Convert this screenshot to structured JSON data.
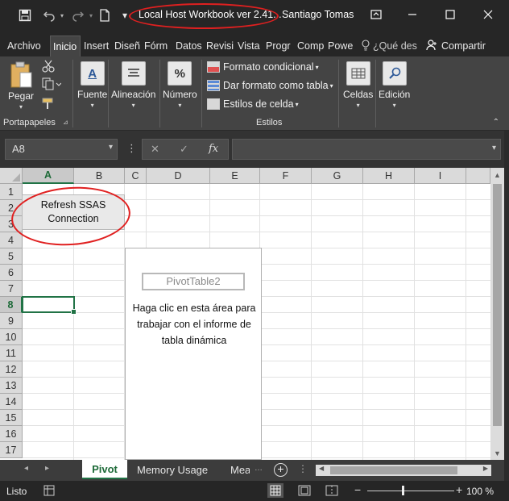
{
  "titlebar": {
    "title": "Local Host Workbook ver 2.41...",
    "user": "Santiago Tomas",
    "save_icon": "save-icon",
    "undo_icon": "undo-icon",
    "redo_icon": "redo-icon",
    "new_icon": "new-file-icon"
  },
  "tabs": {
    "archivo": "Archivo",
    "inicio": "Inicio",
    "insert": "Insert",
    "diseno": "Diseñ",
    "formulas": "Fórm",
    "datos": "Datos",
    "revisar": "Revisi",
    "vista": "Vista",
    "progr": "Progr",
    "comp": "Comp",
    "power": "Powe",
    "tell_me": "¿Qué des",
    "share": "Compartir"
  },
  "ribbon": {
    "pegar": "Pegar",
    "portapapeles": "Portapapeles",
    "fuente": "Fuente",
    "alineacion": "Alineación",
    "numero": "Número",
    "percent": "%",
    "formato_condicional": "Formato condicional",
    "dar_formato_tabla": "Dar formato como tabla",
    "estilos_celda": "Estilos de celda",
    "estilos": "Estilos",
    "celdas": "Celdas",
    "edicion": "Edición"
  },
  "formula_bar": {
    "name_box": "A8",
    "formula": ""
  },
  "grid": {
    "columns": [
      "A",
      "B",
      "C",
      "D",
      "E",
      "F",
      "G",
      "H",
      "I"
    ],
    "rows": [
      "1",
      "2",
      "3",
      "4",
      "5",
      "6",
      "7",
      "8",
      "9",
      "10",
      "11",
      "12",
      "13",
      "14",
      "15",
      "16",
      "17"
    ],
    "selected_cell": "A8"
  },
  "refresh_button": {
    "line1": "Refresh SSAS",
    "line2": "Connection"
  },
  "pivot": {
    "name": "PivotTable2",
    "hint_line1": "Haga clic en esta área para",
    "hint_line2": "trabajar con el informe de",
    "hint_line3": "tabla dinámica"
  },
  "sheets": {
    "tabs": [
      "Pivot",
      "Memory Usage",
      "Mea"
    ],
    "active": "Pivot"
  },
  "status": {
    "ready": "Listo",
    "zoom": "100 %"
  },
  "colors": {
    "accent": "#217346",
    "annotation": "#e02020"
  }
}
